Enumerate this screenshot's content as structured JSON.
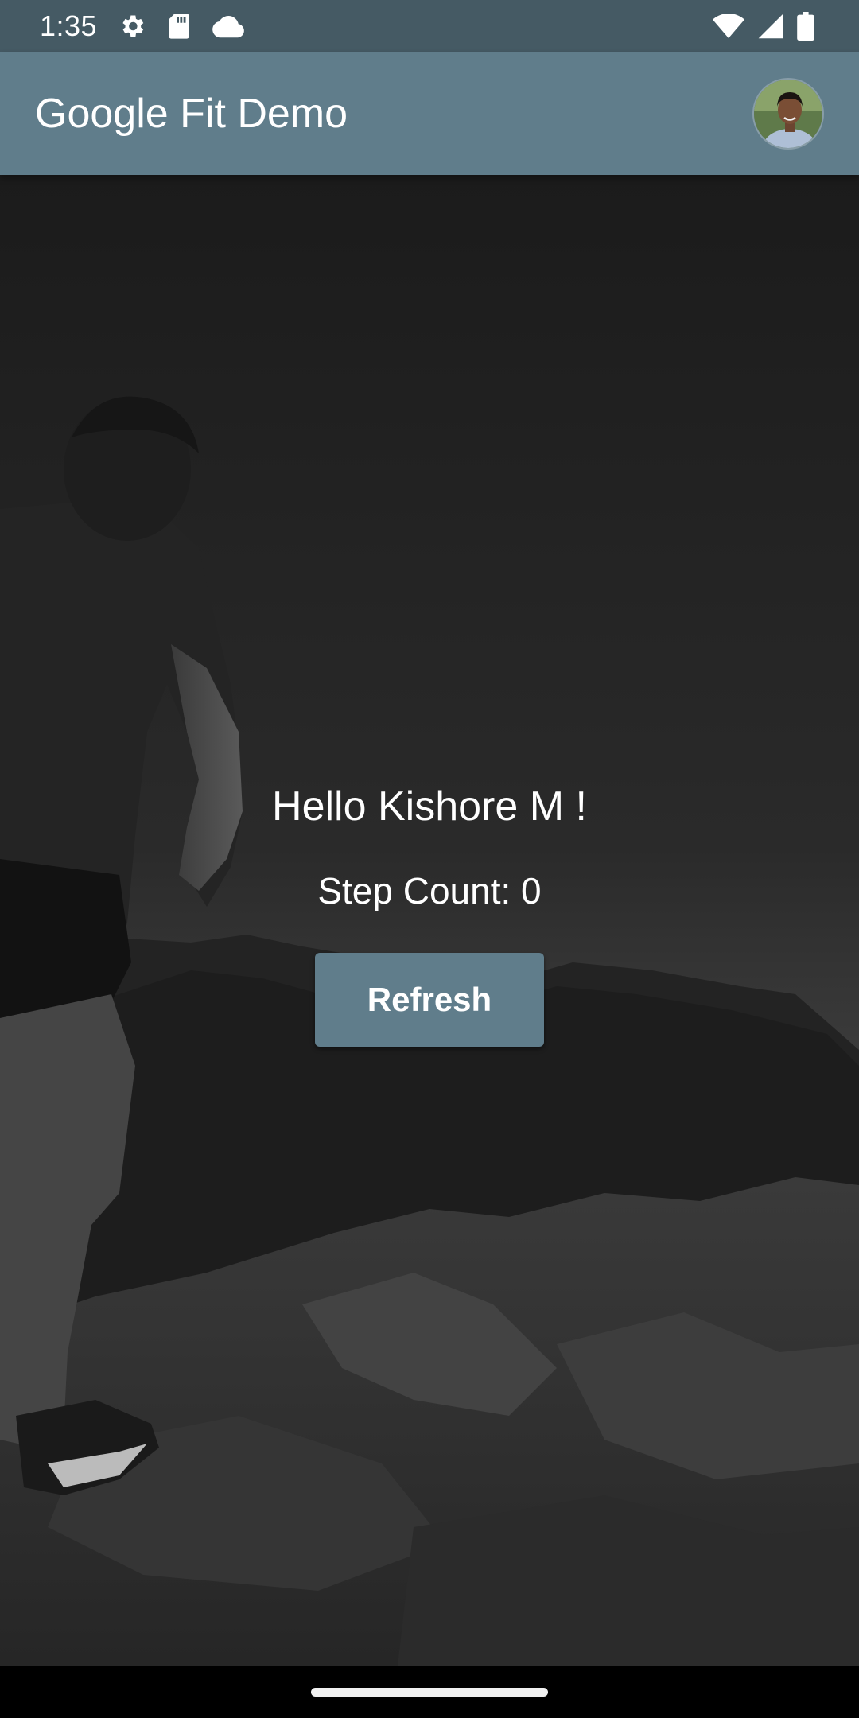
{
  "status_bar": {
    "time": "1:35",
    "left_icons": [
      "gear-icon",
      "sd-card-icon",
      "cloud-icon"
    ],
    "right_icons": [
      "wifi-icon",
      "signal-icon",
      "battery-icon"
    ]
  },
  "app_bar": {
    "title": "Google Fit Demo",
    "color": "#607d8b",
    "avatar_icon": "profile-avatar"
  },
  "main": {
    "greeting": "Hello Kishore M !",
    "step_count_text": "Step Count: 0",
    "refresh_label": "Refresh",
    "background": "runner-on-mountain-photo-dark"
  },
  "colors": {
    "status_bar": "#455a64",
    "primary": "#607d8b",
    "text": "#ffffff"
  }
}
